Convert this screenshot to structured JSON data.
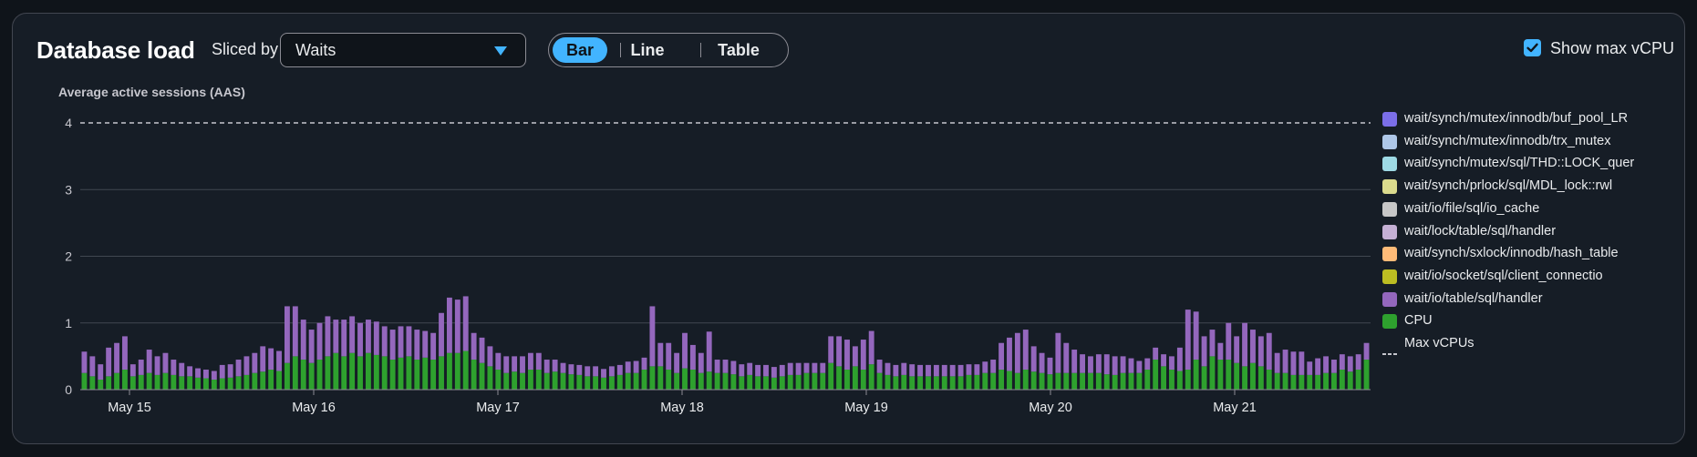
{
  "header": {
    "title": "Database load",
    "sliced_by_label": "Sliced by",
    "sliced_by_value": "Waits",
    "view_tabs": [
      "Bar",
      "Line",
      "Table"
    ],
    "active_tab": "Bar",
    "show_max_vcpu_label": "Show max vCPU",
    "show_max_vcpu_checked": true
  },
  "colors": {
    "accent": "#42b4ff",
    "cpu": "#2ea12e",
    "io_table_handler": "#9467bd",
    "grid": "#414750",
    "max_vcpu_line": "#c6c6cd"
  },
  "chart_data": {
    "type": "bar",
    "stacked": true,
    "ylabel": "Average active sessions (AAS)",
    "ylim": [
      0,
      4
    ],
    "yticks": [
      "0",
      "1",
      "2",
      "3",
      "4"
    ],
    "xticks": [
      "May 15",
      "May 16",
      "May 17",
      "May 18",
      "May 19",
      "May 20",
      "May 21"
    ],
    "max_vcpu": 4,
    "max_vcpu_label": "Max vCPUs",
    "grid": true,
    "legend_position": "right",
    "legend": [
      {
        "name": "wait/synch/mutex/innodb/buf_pool_LR",
        "color": "#7b6ee8"
      },
      {
        "name": "wait/synch/mutex/innodb/trx_mutex",
        "color": "#aec7e8"
      },
      {
        "name": "wait/synch/mutex/sql/THD::LOCK_quer",
        "color": "#9edae5"
      },
      {
        "name": "wait/synch/prlock/sql/MDL_lock::rwl",
        "color": "#dbdb8d"
      },
      {
        "name": "wait/io/file/sql/io_cache",
        "color": "#c7c7c7"
      },
      {
        "name": "wait/lock/table/sql/handler",
        "color": "#c5b0d5"
      },
      {
        "name": "wait/synch/sxlock/innodb/hash_table",
        "color": "#ffbb78"
      },
      {
        "name": "wait/io/socket/sql/client_connectio",
        "color": "#bcbd22"
      },
      {
        "name": "wait/io/table/sql/handler",
        "color": "#9467bd"
      },
      {
        "name": "CPU",
        "color": "#2ea12e"
      }
    ],
    "series": [
      {
        "name": "CPU",
        "values": [
          0.25,
          0.2,
          0.15,
          0.2,
          0.25,
          0.3,
          0.2,
          0.22,
          0.25,
          0.22,
          0.25,
          0.22,
          0.2,
          0.2,
          0.18,
          0.17,
          0.15,
          0.17,
          0.18,
          0.2,
          0.22,
          0.25,
          0.27,
          0.3,
          0.28,
          0.4,
          0.5,
          0.45,
          0.4,
          0.45,
          0.5,
          0.55,
          0.5,
          0.55,
          0.5,
          0.55,
          0.52,
          0.5,
          0.45,
          0.48,
          0.5,
          0.45,
          0.48,
          0.45,
          0.5,
          0.55,
          0.55,
          0.58,
          0.45,
          0.4,
          0.35,
          0.3,
          0.25,
          0.27,
          0.25,
          0.3,
          0.3,
          0.25,
          0.27,
          0.25,
          0.23,
          0.22,
          0.2,
          0.2,
          0.18,
          0.2,
          0.22,
          0.25,
          0.25,
          0.3,
          0.35,
          0.35,
          0.3,
          0.25,
          0.32,
          0.3,
          0.25,
          0.27,
          0.25,
          0.25,
          0.23,
          0.2,
          0.22,
          0.2,
          0.2,
          0.18,
          0.2,
          0.22,
          0.22,
          0.25,
          0.25,
          0.25,
          0.4,
          0.35,
          0.3,
          0.35,
          0.3,
          0.38,
          0.25,
          0.22,
          0.2,
          0.22,
          0.2,
          0.2,
          0.2,
          0.2,
          0.2,
          0.2,
          0.2,
          0.22,
          0.22,
          0.25,
          0.25,
          0.3,
          0.28,
          0.25,
          0.3,
          0.27,
          0.25,
          0.23,
          0.25,
          0.25,
          0.25,
          0.25,
          0.25,
          0.25,
          0.23,
          0.22,
          0.25,
          0.25,
          0.25,
          0.3,
          0.45,
          0.35,
          0.3,
          0.28,
          0.3,
          0.45,
          0.35,
          0.5,
          0.45,
          0.45,
          0.4,
          0.35,
          0.4,
          0.35,
          0.3,
          0.25,
          0.25,
          0.22,
          0.22,
          0.22,
          0.22,
          0.25,
          0.25,
          0.3,
          0.27,
          0.3,
          0.45
        ]
      },
      {
        "name": "wait/io/table/sql/handler",
        "values": [
          0.32,
          0.3,
          0.23,
          0.43,
          0.45,
          0.5,
          0.18,
          0.23,
          0.35,
          0.28,
          0.3,
          0.23,
          0.2,
          0.15,
          0.14,
          0.13,
          0.13,
          0.2,
          0.2,
          0.25,
          0.28,
          0.3,
          0.38,
          0.32,
          0.3,
          0.85,
          0.75,
          0.6,
          0.5,
          0.55,
          0.6,
          0.5,
          0.55,
          0.55,
          0.5,
          0.5,
          0.5,
          0.45,
          0.45,
          0.47,
          0.45,
          0.45,
          0.4,
          0.4,
          0.65,
          0.83,
          0.8,
          0.82,
          0.4,
          0.38,
          0.3,
          0.25,
          0.25,
          0.23,
          0.25,
          0.25,
          0.25,
          0.2,
          0.18,
          0.15,
          0.15,
          0.15,
          0.15,
          0.15,
          0.13,
          0.15,
          0.15,
          0.17,
          0.18,
          0.18,
          0.9,
          0.35,
          0.4,
          0.3,
          0.53,
          0.37,
          0.3,
          0.6,
          0.2,
          0.2,
          0.2,
          0.18,
          0.18,
          0.17,
          0.17,
          0.16,
          0.17,
          0.18,
          0.18,
          0.15,
          0.15,
          0.15,
          0.4,
          0.45,
          0.45,
          0.3,
          0.45,
          0.5,
          0.2,
          0.18,
          0.17,
          0.18,
          0.18,
          0.17,
          0.17,
          0.17,
          0.17,
          0.17,
          0.17,
          0.16,
          0.16,
          0.17,
          0.2,
          0.4,
          0.5,
          0.6,
          0.6,
          0.38,
          0.3,
          0.25,
          0.6,
          0.45,
          0.35,
          0.28,
          0.25,
          0.28,
          0.3,
          0.28,
          0.25,
          0.22,
          0.18,
          0.17,
          0.18,
          0.18,
          0.2,
          0.35,
          0.9,
          0.72,
          0.45,
          0.4,
          0.25,
          0.55,
          0.4,
          0.65,
          0.5,
          0.45,
          0.55,
          0.3,
          0.35,
          0.35,
          0.35,
          0.2,
          0.25,
          0.25,
          0.2,
          0.23,
          0.23,
          0.23,
          0.25,
          0.25,
          0.33,
          0.47,
          0.77
        ]
      }
    ]
  }
}
